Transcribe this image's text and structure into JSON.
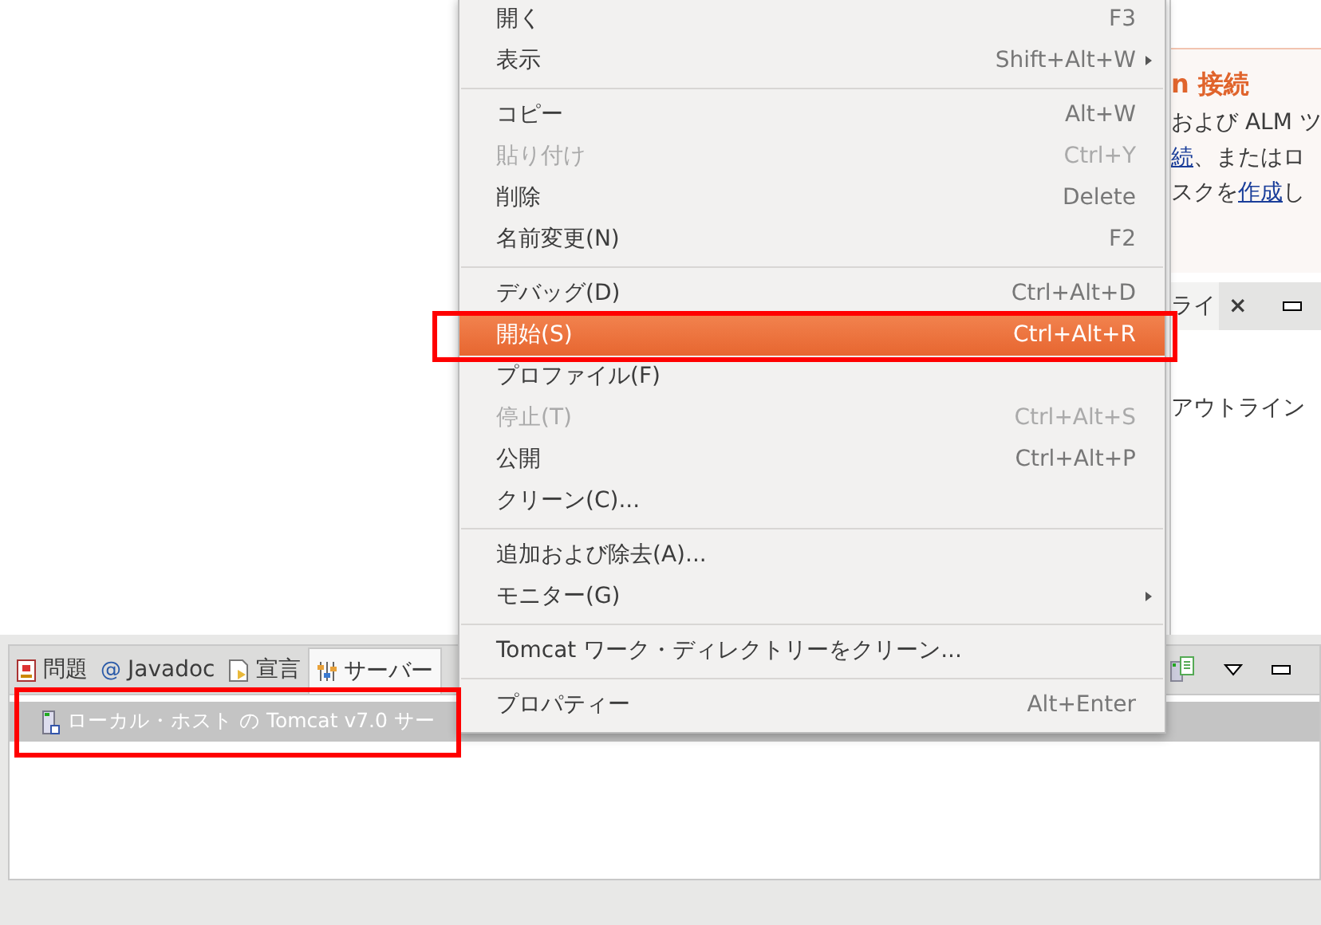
{
  "side_panel": {
    "heading": "n 接続",
    "lines": [
      [
        {
          "text": "および ALM ツ",
          "link": false
        }
      ],
      [
        {
          "text": "続",
          "link": true
        },
        {
          "text": "、またはロ",
          "link": false
        }
      ],
      [
        {
          "text": "スクを",
          "link": false
        },
        {
          "text": "作成",
          "link": true
        },
        {
          "text": "し",
          "link": false
        }
      ]
    ],
    "tab": {
      "label": "ライ",
      "close": "×"
    },
    "outline_text": "アウトライン"
  },
  "bottom_panel": {
    "tabs": [
      {
        "label": "問題",
        "selected": false
      },
      {
        "label": "Javadoc",
        "symbol": "@",
        "selected": false
      },
      {
        "label": "宣言",
        "selected": false
      },
      {
        "label": "サーバー",
        "selected": true
      }
    ],
    "rows": [
      {
        "text": "ローカル・ホスト の Tomcat v7.0 サー",
        "selected": true
      }
    ]
  },
  "context_menu": {
    "groups": [
      [
        {
          "label": "開く",
          "shortcut": "F3",
          "disabled": false,
          "selected": false,
          "submenu": false
        },
        {
          "label": "表示",
          "shortcut": "Shift+Alt+W",
          "disabled": false,
          "selected": false,
          "submenu": true
        }
      ],
      [
        {
          "label": "コピー",
          "shortcut": "Alt+W",
          "disabled": false,
          "selected": false,
          "submenu": false
        },
        {
          "label": "貼り付け",
          "shortcut": "Ctrl+Y",
          "disabled": true,
          "selected": false,
          "submenu": false
        },
        {
          "label": "削除",
          "shortcut": "Delete",
          "disabled": false,
          "selected": false,
          "submenu": false
        },
        {
          "label": "名前変更(N)",
          "shortcut": "F2",
          "disabled": false,
          "selected": false,
          "submenu": false
        }
      ],
      [
        {
          "label": "デバッグ(D)",
          "shortcut": "Ctrl+Alt+D",
          "disabled": false,
          "selected": false,
          "submenu": false
        },
        {
          "label": "開始(S)",
          "shortcut": "Ctrl+Alt+R",
          "disabled": false,
          "selected": true,
          "submenu": false
        },
        {
          "label": "プロファイル(F)",
          "disabled": false,
          "selected": false,
          "submenu": false
        },
        {
          "label": "停止(T)",
          "shortcut": "Ctrl+Alt+S",
          "disabled": true,
          "selected": false,
          "submenu": false
        },
        {
          "label": "公開",
          "shortcut": "Ctrl+Alt+P",
          "disabled": false,
          "selected": false,
          "submenu": false
        },
        {
          "label": "クリーン(C)...",
          "disabled": false,
          "selected": false,
          "submenu": false
        }
      ],
      [
        {
          "label": "追加および除去(A)...",
          "disabled": false,
          "selected": false,
          "submenu": false
        },
        {
          "label": "モニター(G)",
          "disabled": false,
          "selected": false,
          "submenu": true
        }
      ],
      [
        {
          "label": "Tomcat ワーク・ディレクトリーをクリーン...",
          "disabled": false,
          "selected": false,
          "submenu": false
        }
      ],
      [
        {
          "label": "プロパティー",
          "shortcut": "Alt+Enter",
          "disabled": false,
          "selected": false,
          "submenu": false
        }
      ]
    ]
  }
}
